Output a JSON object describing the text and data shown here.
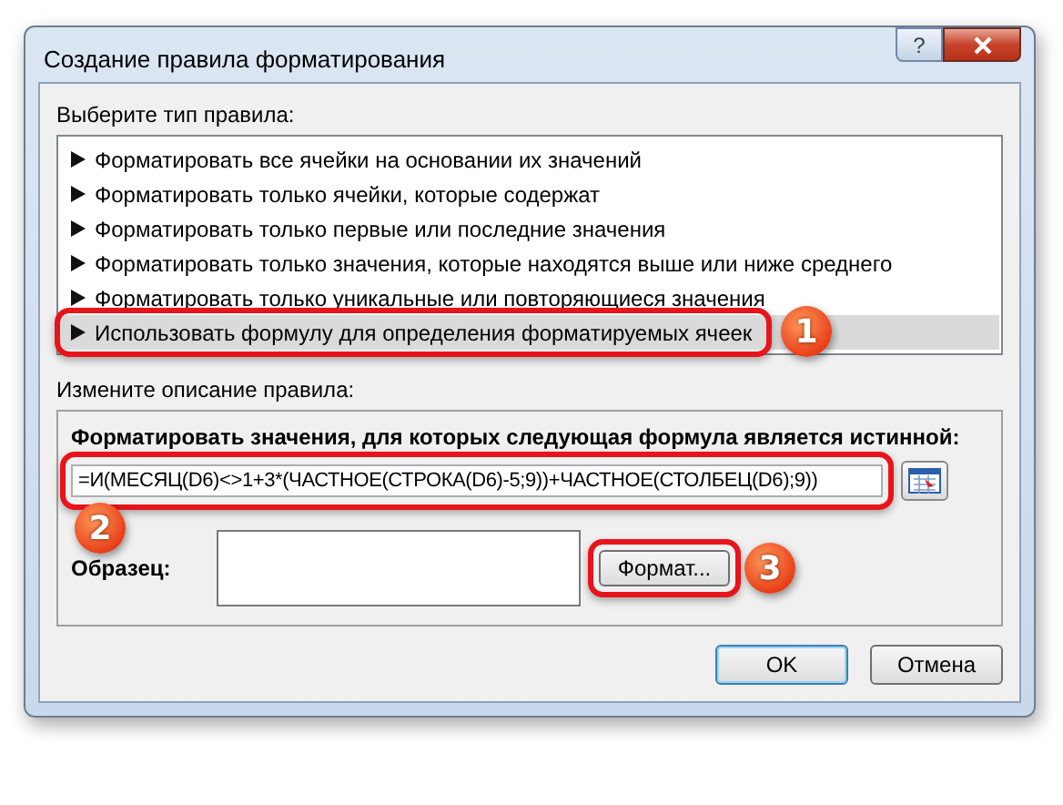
{
  "window": {
    "title": "Создание правила форматирования",
    "help_button": "?"
  },
  "rule_type_label": "Выберите тип правила:",
  "rules": [
    {
      "label": "Форматировать все ячейки на основании их значений",
      "selected": false
    },
    {
      "label": "Форматировать только ячейки, которые содержат",
      "selected": false
    },
    {
      "label": "Форматировать только первые или последние значения",
      "selected": false
    },
    {
      "label": "Форматировать только значения, которые находятся выше или ниже среднего",
      "selected": false
    },
    {
      "label": "Форматировать только уникальные или повторяющиеся значения",
      "selected": false
    },
    {
      "label": "Использовать формулу для определения форматируемых ячеек",
      "selected": true,
      "callout": "1"
    }
  ],
  "description_label": "Измените описание правила:",
  "formula_label": "Форматировать значения, для которых следующая формула является истинной:",
  "formula": {
    "value": "=И(МЕСЯЦ(D6)<>1+3*(ЧАСТНОЕ(СТРОКА(D6)-5;9))+ЧАСТНОЕ(СТОЛБЕЦ(D6);9))",
    "callout": "2"
  },
  "sample_label": "Образец:",
  "format_button": {
    "label": "Формат...",
    "callout": "3"
  },
  "buttons": [
    {
      "label": "OK",
      "default": true
    },
    {
      "label": "Отмена",
      "default": false
    }
  ]
}
